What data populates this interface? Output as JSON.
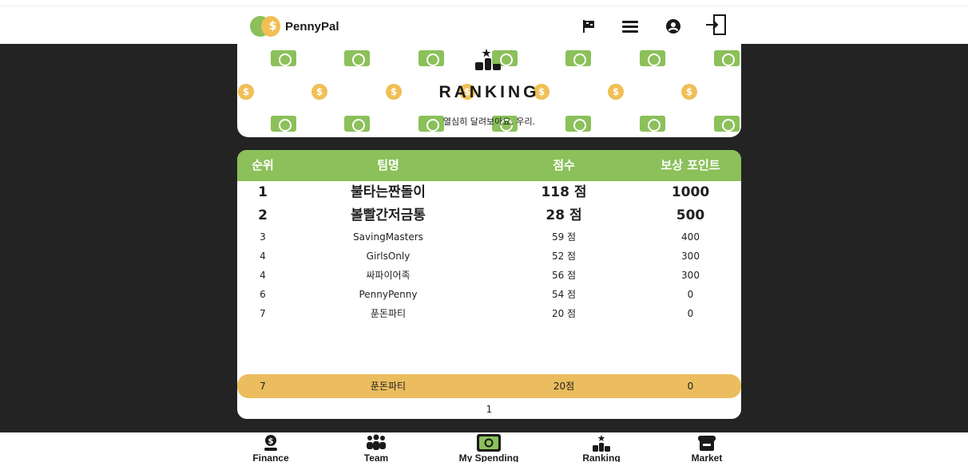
{
  "header": {
    "logo_symbol": "$",
    "app_name": "PennyPal",
    "icons": [
      "flag-icon",
      "menu-icon",
      "account-icon",
      "logout-icon"
    ]
  },
  "hero": {
    "icon": "podium-icon",
    "title": "RANKING",
    "subtitle": "열심히 달려보아요, 우리.",
    "coin_symbol": "$"
  },
  "table": {
    "headers": {
      "rank": "순위",
      "team": "팀명",
      "score": "점수",
      "reward": "보상 포인트"
    },
    "rows": [
      {
        "rank": "1",
        "team": "불타는짠돌이",
        "score": "118 점",
        "reward": "1000"
      },
      {
        "rank": "2",
        "team": "볼빨간저금통",
        "score": "28 점",
        "reward": "500"
      },
      {
        "rank": "3",
        "team": "SavingMasters",
        "score": "59 점",
        "reward": "400"
      },
      {
        "rank": "4",
        "team": "GirlsOnly",
        "score": "52 점",
        "reward": "300"
      },
      {
        "rank": "4",
        "team": "싸파이어족",
        "score": "56 점",
        "reward": "300"
      },
      {
        "rank": "6",
        "team": "PennyPenny",
        "score": "54 점",
        "reward": "0"
      },
      {
        "rank": "7",
        "team": "푼돈파티",
        "score": "20 점",
        "reward": "0"
      }
    ],
    "my_team": {
      "rank": "7",
      "team": "푼돈파티",
      "score": "20점",
      "reward": "0"
    },
    "page": "1"
  },
  "bottom_nav": [
    {
      "label": "Finance",
      "icon": "finance-icon"
    },
    {
      "label": "Team",
      "icon": "team-icon"
    },
    {
      "label": "My Spending",
      "icon": "my-spending-icon"
    },
    {
      "label": "Ranking",
      "icon": "ranking-icon"
    },
    {
      "label": "Market",
      "icon": "market-icon"
    }
  ],
  "colors": {
    "accent_green": "#8bc05a",
    "accent_gold": "#ebbd5f",
    "dark_bg": "#232323"
  }
}
